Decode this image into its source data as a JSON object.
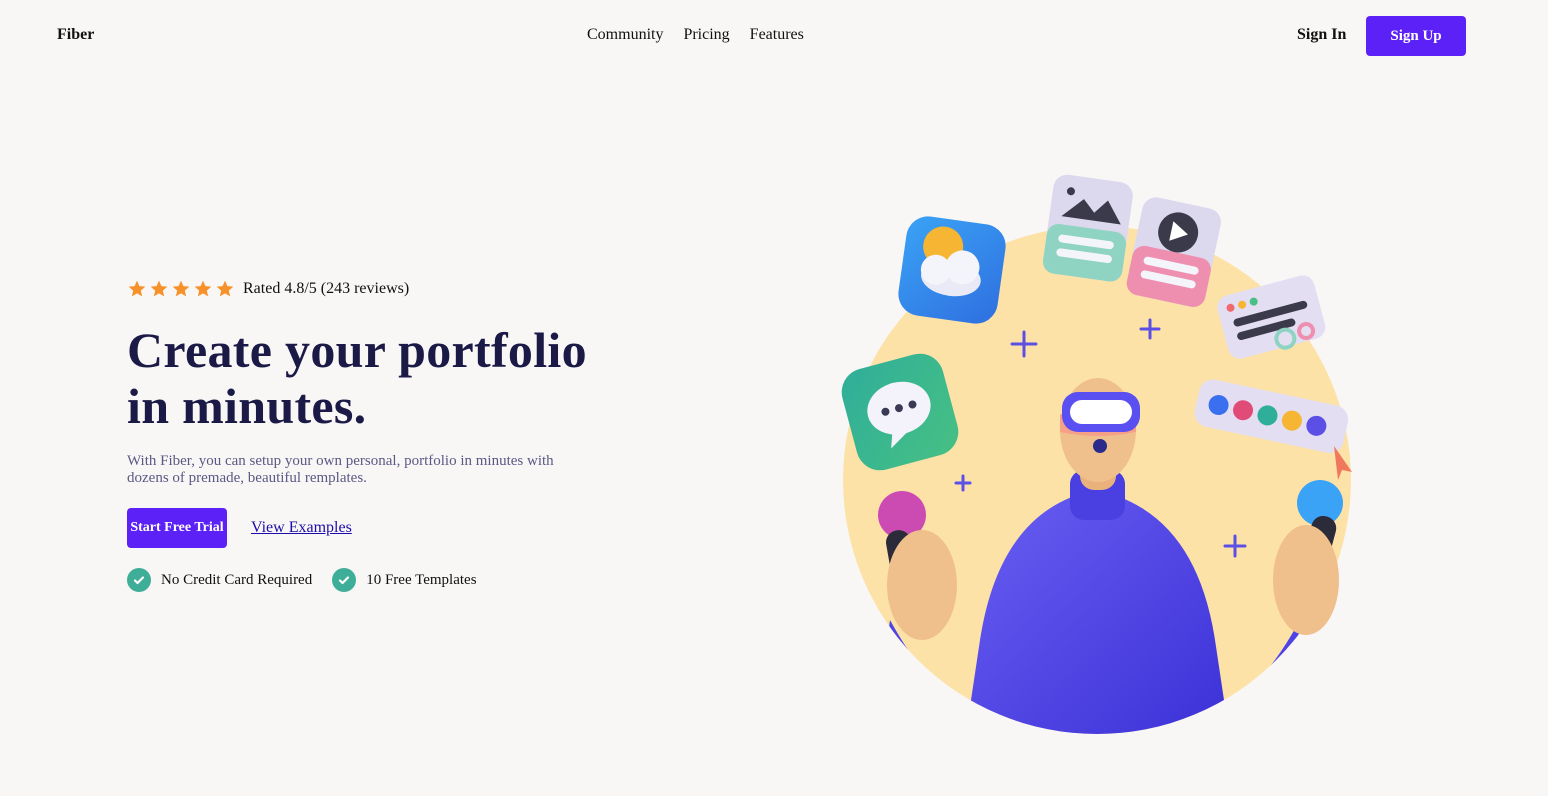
{
  "nav": {
    "brand": "Fiber",
    "links": [
      "Community",
      "Pricing",
      "Features"
    ],
    "sign_in": "Sign In",
    "sign_up": "Sign Up"
  },
  "hero": {
    "rating": {
      "stars": 5,
      "text": "Rated 4.8/5 (243 reviews)"
    },
    "headline_line1": "Create your portfolio",
    "headline_line2": "in minutes.",
    "description": "With Fiber, you can setup your own personal, portfolio in minutes with dozens of premade, beautiful remplates.",
    "cta_label": "Start Free Trial",
    "secondary_link": "View Examples",
    "perks": [
      "No Credit Card Required",
      "10 Free Templates"
    ]
  },
  "colors": {
    "accent": "#5b21f6",
    "headline": "#1b1a46",
    "star": "#f7922b",
    "check": "#3fae98",
    "circle": "#fde2a8"
  },
  "icons": [
    "star-icon",
    "check-icon",
    "weather-app-icon",
    "chat-app-icon",
    "gallery-card-icon",
    "play-card-icon",
    "code-card-icon",
    "color-palette-icon",
    "cursor-icon"
  ]
}
